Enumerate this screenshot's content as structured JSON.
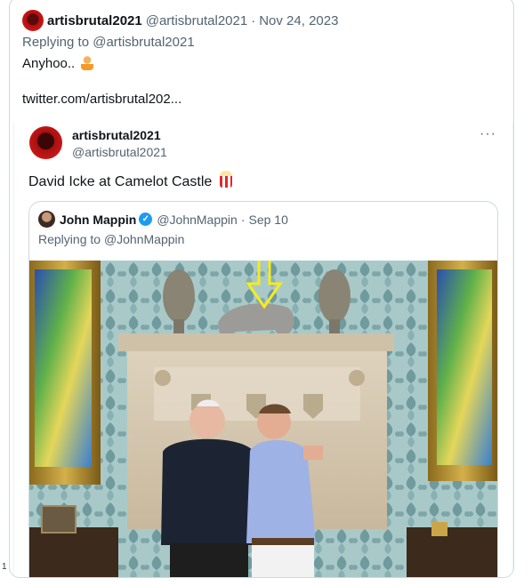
{
  "tweet": {
    "display_name": "artisbrutal2021",
    "handle": "@artisbrutal2021",
    "separator": "·",
    "date": "Nov 24, 2023",
    "replying_prefix": "Replying to ",
    "replying_handle": "@artisbrutal2021",
    "text": "Anyhoo..",
    "text_emoji": "person-gesturing-emoji",
    "link": "twitter.com/artisbrutal202..."
  },
  "quoted_tweet": {
    "display_name": "artisbrutal2021",
    "handle": "@artisbrutal2021",
    "more": "···",
    "text": "David Icke at Camelot Castle",
    "text_emoji": "popcorn-emoji",
    "nested_quote": {
      "display_name": "John Mappin",
      "verified": true,
      "handle": "@JohnMappin",
      "separator": "·",
      "date": "Sep 10",
      "replying_prefix": "Replying to ",
      "replying_handle": "@JohnMappin",
      "image_description": "photo-two-men-by-fireplace"
    }
  },
  "page_number": "1",
  "colors": {
    "accent_blue": "#1d9bf0",
    "muted_text": "#536471",
    "arrow_yellow": "#f5ec1c",
    "border": "#cfd9de"
  }
}
